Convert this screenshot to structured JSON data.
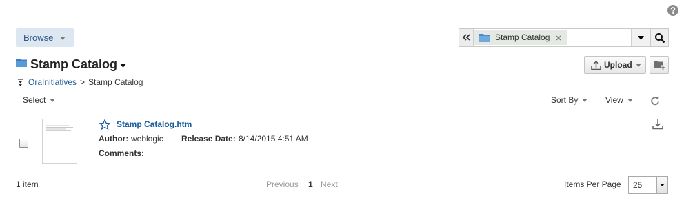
{
  "icons": {
    "help": "help-icon",
    "browse_arrow": "chevron-down-icon",
    "collapse": "double-chevron-left-icon",
    "chip_folder": "folder-icon",
    "chip_remove": "close-icon",
    "search_dropdown": "triangle-down-icon",
    "search": "search-icon",
    "title_folder": "folder-icon",
    "title_dropdown": "triangle-down-icon",
    "upload": "upload-icon",
    "new_folder": "folder-add-icon",
    "breadcrumb_toggle": "breadcrumb-collapse-icon",
    "refresh": "refresh-icon",
    "favorite": "star-icon",
    "download": "download-icon"
  },
  "colors": {
    "accent": "#1a5b9c",
    "browse_bg": "#dde7f1",
    "chip_bg": "#e4e9e3",
    "folder_blue": "#5b9bd5",
    "disabled_text": "#9a9a9a"
  },
  "browse": {
    "label": "Browse"
  },
  "search": {
    "chip_label": "Stamp Catalog",
    "query": ""
  },
  "folder": {
    "title": "Stamp Catalog"
  },
  "actions": {
    "upload_label": "Upload"
  },
  "breadcrumb": {
    "items": [
      {
        "label": "OraInitiatives"
      }
    ],
    "separator": ">",
    "current": "Stamp Catalog"
  },
  "toolbar": {
    "select_label": "Select",
    "sort_label": "Sort By",
    "view_label": "View"
  },
  "items": [
    {
      "name": "Stamp Catalog.htm",
      "author_label": "Author:",
      "author": "weblogic",
      "release_label": "Release Date:",
      "release_date": "8/14/2015 4:51 AM",
      "comments_label": "Comments:",
      "comments": "",
      "checked": false
    }
  ],
  "footer": {
    "count": "1 item",
    "previous": "Previous",
    "page": "1",
    "next": "Next",
    "per_page_label": "Items Per Page",
    "per_page_value": "25"
  }
}
